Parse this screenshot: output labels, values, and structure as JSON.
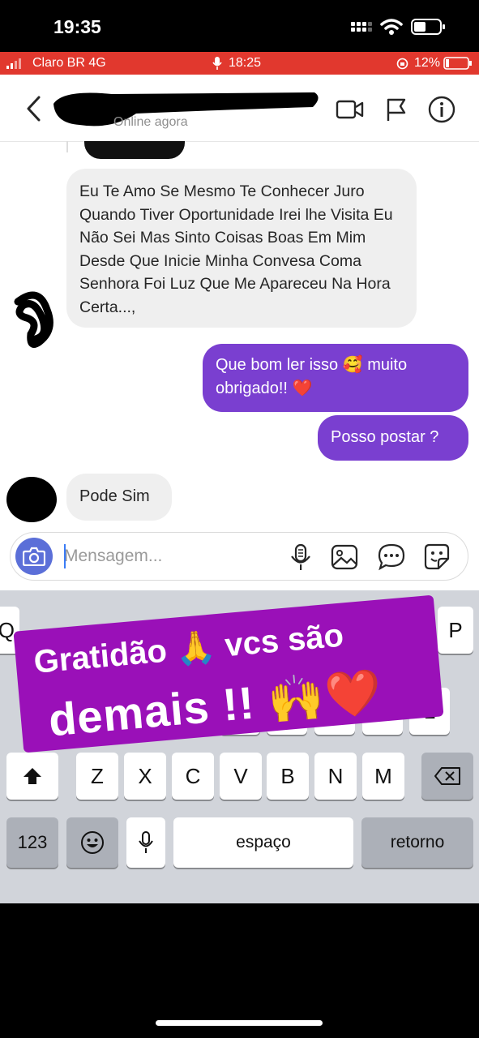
{
  "outer_status": {
    "time": "19:35",
    "icons": [
      "signal-dots-icon",
      "wifi-icon",
      "battery-icon"
    ]
  },
  "inner_status": {
    "carrier": "Claro BR 4G",
    "time": "18:25",
    "battery": "12%",
    "bar_color": "#e1382e"
  },
  "chat_header": {
    "presence": "Online agora",
    "icons": [
      "back-chevron-icon",
      "video-call-icon",
      "flag-icon",
      "info-icon"
    ]
  },
  "messages": [
    {
      "sender": "other",
      "text": "Eu Te Amo Se Mesmo Te Conhecer Juro Quando Tiver Oportunidade Irei lhe Visita Eu Não Sei Mas Sinto Coisas Boas Em Mim Desde Que Inicie Minha Convesa Coma Senhora Foi Luz Que Me Apareceu Na Hora Certa...,"
    },
    {
      "sender": "me",
      "text": "Que bom ler  isso 🥰  muito obrigado!! ❤️"
    },
    {
      "sender": "me",
      "text": "Posso postar ?"
    },
    {
      "sender": "other",
      "text": "Pode Sim"
    }
  ],
  "composer": {
    "placeholder": "Mensagem...",
    "icons": [
      "camera-icon",
      "microphone-icon",
      "gallery-icon",
      "chat-bubble-icon",
      "sticker-icon"
    ]
  },
  "keyboard": {
    "row2": [
      "A",
      "S",
      "D",
      "F",
      "G",
      "H",
      "J",
      "K",
      "L"
    ],
    "row3": [
      "Z",
      "X",
      "C",
      "V",
      "B",
      "N",
      "M"
    ],
    "numbers_key": "123",
    "space_key": "espaço",
    "return_key": "retorno",
    "edge_keys": {
      "left": "Q",
      "right": "P"
    }
  },
  "sticker": {
    "line1": "Gratidão 🙏 vcs são",
    "line2": "demais !! 🙌❤️",
    "bg_color": "#9a10b8"
  },
  "colors": {
    "accent_purple": "#7a3fd0",
    "incoming_bubble": "#efefef"
  }
}
